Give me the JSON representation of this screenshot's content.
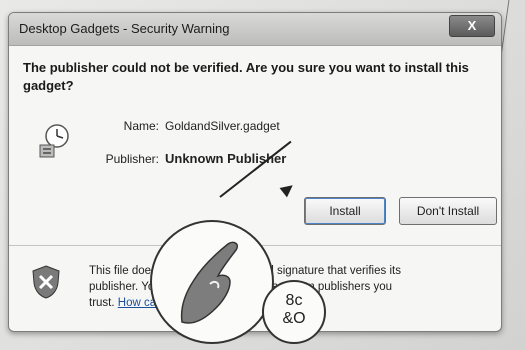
{
  "dialog": {
    "title": "Desktop Gadgets - Security Warning",
    "close_label": "X",
    "headline": "The publisher could not be verified. Are you sure you want to install this gadget?",
    "name_label": "Name:",
    "name_value": "GoldandSilver.gadget",
    "publisher_label": "Publisher:",
    "publisher_value": "Unknown Publisher",
    "install_label": "Install",
    "dont_install_label": "Don't Install",
    "footer_line1": "This file does not have a valid digital signature that verifies its",
    "footer_line2": "publisher. You should only run software from publishers you",
    "footer_line3_prefix": "trust.",
    "footer_link": "How can I decide what software to run?"
  },
  "overlay": {
    "small_magnifier_text": "8c\n&O"
  },
  "icons": {
    "close": "close-icon",
    "gadget": "gadget-icon",
    "shield": "shield-icon"
  },
  "colors": {
    "dialog_bg": "#f6f6f4",
    "link": "#1a4f9c",
    "accent_focus": "#4d84c8"
  }
}
